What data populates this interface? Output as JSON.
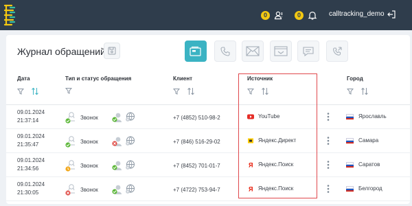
{
  "topbar": {
    "badge1": "0",
    "badge2": "0",
    "user": "calltracking_demo"
  },
  "page": {
    "title": "Журнал обращений"
  },
  "channels": [
    {
      "name": "channel-all",
      "icon": "channels-icon",
      "active": true
    },
    {
      "name": "channel-calls",
      "icon": "phone-icon",
      "active": false
    },
    {
      "name": "channel-email",
      "icon": "mail-icon",
      "active": false
    },
    {
      "name": "channel-form",
      "icon": "form-icon",
      "active": false
    },
    {
      "name": "channel-chat",
      "icon": "chat-icon",
      "active": false
    },
    {
      "name": "channel-callback",
      "icon": "callback-icon",
      "active": false
    }
  ],
  "columns": {
    "date": "Дата",
    "type": "Тип и статус обращения",
    "client": "Клиент",
    "source": "Источник",
    "city": "Город"
  },
  "rows": [
    {
      "date": "09.01.2024",
      "time": "21:37:14",
      "type": "Звонок",
      "type_status": "success",
      "status": "success",
      "client": "+7 (4852) 510-98-2",
      "source": "YouTube",
      "source_icon": "youtube-icon",
      "city": "Ярославль"
    },
    {
      "date": "09.01.2024",
      "time": "21:35:47",
      "type": "Звонок",
      "type_status": "success",
      "status": "missed",
      "client": "+7 (846) 516-29-02",
      "source": "Яндекс.Директ",
      "source_icon": "yandex-direct-icon",
      "city": "Самара"
    },
    {
      "date": "09.01.2024",
      "time": "21:34:56",
      "type": "Звонок",
      "type_status": "pending",
      "status": "success",
      "client": "+7 (8452) 701-01-7",
      "source": "Яндекс.Поиск",
      "source_icon": "yandex-icon",
      "city": "Саратов"
    },
    {
      "date": "09.01.2024",
      "time": "21:30:05",
      "type": "Звонок",
      "type_status": "missed",
      "status": "success",
      "client": "+7 (4722) 753-94-7",
      "source": "Яндекс.Поиск",
      "source_icon": "yandex-icon",
      "city": "Белгород"
    }
  ],
  "colors": {
    "topbar": "#2f3d4c",
    "accent": "#3bb3c3",
    "badge": "#f3c812",
    "highlight": "#e0474c",
    "success": "#5fb83c",
    "missed": "#e1504a",
    "pending": "#f2a81d"
  }
}
